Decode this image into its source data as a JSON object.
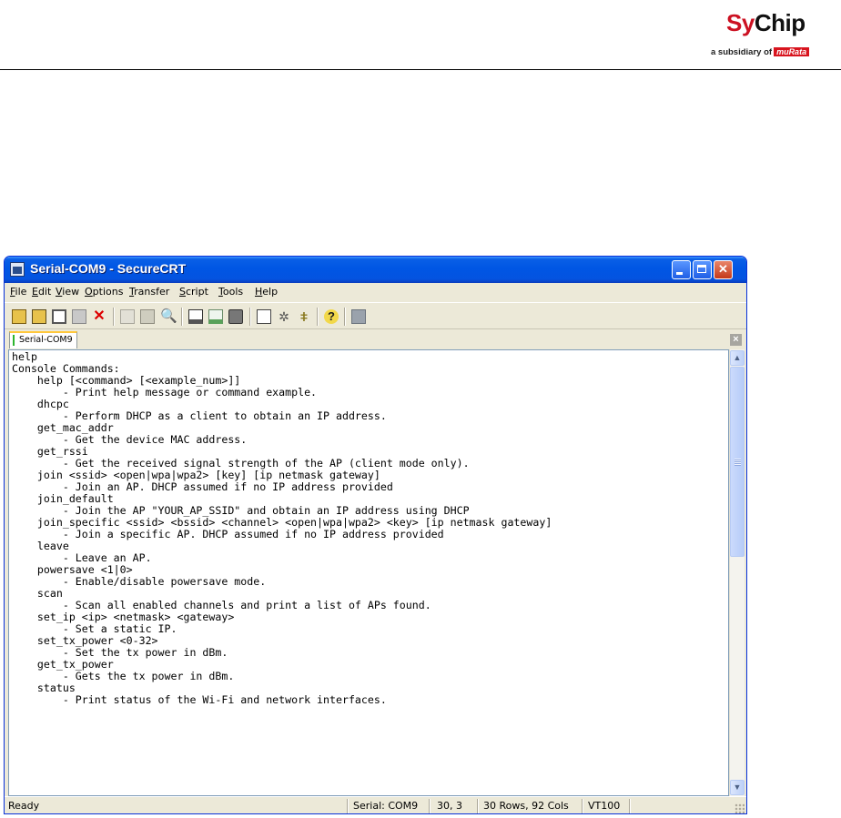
{
  "doc_header": {
    "logo_left": "Sy",
    "logo_right": "Chip",
    "logo_sub": "a subsidiary of",
    "logo_brand": "muRata"
  },
  "window": {
    "title": "Serial-COM9 - SecureCRT",
    "menu": [
      "File",
      "Edit",
      "View",
      "Options",
      "Transfer",
      "Script",
      "Tools",
      "Help"
    ],
    "toolbar_icons": [
      "connect-icon",
      "quick-connect-icon",
      "connect-tab-icon",
      "reconnect-icon",
      "disconnect-icon",
      "copy-icon",
      "paste-icon",
      "find-icon",
      "print-screen-icon",
      "print-selection-icon",
      "print-icon",
      "session-options-icon",
      "global-options-icon",
      "keymap-icon",
      "help-icon",
      "sftp-icon"
    ],
    "tab_label": "Serial-COM9",
    "terminal_lines": [
      "help",
      "Console Commands:",
      "    help [<command> [<example_num>]]",
      "        - Print help message or command example.",
      "    dhcpc",
      "        - Perform DHCP as a client to obtain an IP address.",
      "    get_mac_addr",
      "        - Get the device MAC address.",
      "    get_rssi",
      "        - Get the received signal strength of the AP (client mode only).",
      "    join <ssid> <open|wpa|wpa2> [key] [ip netmask gateway]",
      "        - Join an AP. DHCP assumed if no IP address provided",
      "    join_default",
      "        - Join the AP \"YOUR_AP_SSID\" and obtain an IP address using DHCP",
      "    join_specific <ssid> <bssid> <channel> <open|wpa|wpa2> <key> [ip netmask gateway]",
      "        - Join a specific AP. DHCP assumed if no IP address provided",
      "    leave",
      "        - Leave an AP.",
      "    powersave <1|0>",
      "        - Enable/disable powersave mode.",
      "    scan",
      "        - Scan all enabled channels and print a list of APs found.",
      "    set_ip <ip> <netmask> <gateway>",
      "        - Set a static IP.",
      "    set_tx_power <0-32>",
      "        - Set the tx power in dBm.",
      "    get_tx_power",
      "        - Gets the tx power in dBm.",
      "    status",
      "        - Print status of the Wi-Fi and network interfaces."
    ],
    "status": {
      "state": "Ready",
      "serial": "Serial: COM9",
      "cursor": "30,  3",
      "size": "30 Rows, 92 Cols",
      "emulation": "VT100"
    }
  }
}
